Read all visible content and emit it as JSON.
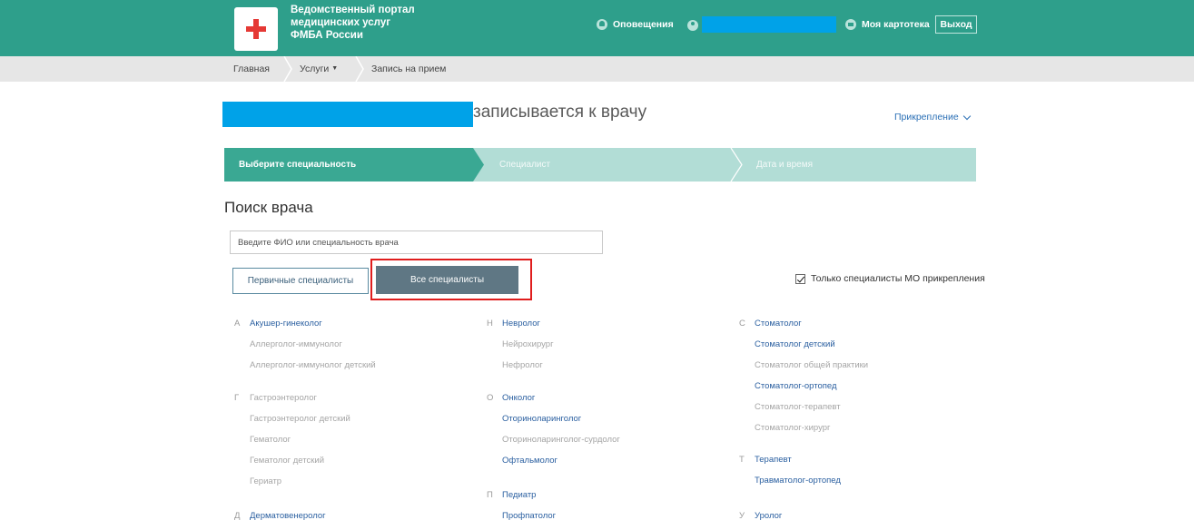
{
  "header": {
    "portal_title_lines": [
      "Ведомственный портал",
      "медицинских услуг",
      "ФМБА России"
    ],
    "notifications_label": "Оповещения",
    "my_card_label": "Моя картотека",
    "exit_label": "Выход",
    "brand_color": "#2e9f8b"
  },
  "breadcrumb": {
    "items": [
      "Главная",
      "Услуги",
      "Запись на прием"
    ]
  },
  "page": {
    "title": "записывается к врачу",
    "attachment_label": "Прикрепление"
  },
  "steps": [
    {
      "label": "Выберите специальность",
      "active": true
    },
    {
      "label": "Специалист",
      "active": false
    },
    {
      "label": "Дата и время",
      "active": false
    }
  ],
  "search": {
    "title": "Поиск врача",
    "placeholder": "Введите ФИО или специальность врача",
    "primary_button": "Первичные специалисты",
    "all_button": "Все специалисты",
    "only_mo_label": "Только специалисты МО прикрепления",
    "only_mo_checked": true
  },
  "specialists": {
    "col_a": [
      {
        "letter": "А",
        "name": "Акушер-гинеколог",
        "active": true
      },
      {
        "letter": "",
        "name": "Аллерголог-иммунолог",
        "active": false
      },
      {
        "letter": "",
        "name": "Аллерголог-иммунолог детский",
        "active": false
      },
      {
        "letter": "Г",
        "name": "Гастроэнтеролог",
        "active": false
      },
      {
        "letter": "",
        "name": "Гастроэнтеролог детский",
        "active": false
      },
      {
        "letter": "",
        "name": "Гематолог",
        "active": false
      },
      {
        "letter": "",
        "name": "Гематолог детский",
        "active": false
      },
      {
        "letter": "",
        "name": "Гериатр",
        "active": false
      },
      {
        "letter": "Д",
        "name": "Дерматовенеролог",
        "active": true
      }
    ],
    "col_b": [
      {
        "letter": "Н",
        "name": "Невролог",
        "active": true
      },
      {
        "letter": "",
        "name": "Нейрохирург",
        "active": false
      },
      {
        "letter": "",
        "name": "Нефролог",
        "active": false
      },
      {
        "letter": "О",
        "name": "Онколог",
        "active": true
      },
      {
        "letter": "",
        "name": "Оториноларинголог",
        "active": true
      },
      {
        "letter": "",
        "name": "Оториноларинголог-сурдолог",
        "active": false
      },
      {
        "letter": "",
        "name": "Офтальмолог",
        "active": true
      },
      {
        "letter": "П",
        "name": "Педиатр",
        "active": true
      },
      {
        "letter": "",
        "name": "Профпатолог",
        "active": true
      }
    ],
    "col_c": [
      {
        "letter": "С",
        "name": "Стоматолог",
        "active": true
      },
      {
        "letter": "",
        "name": "Стоматолог детский",
        "active": true
      },
      {
        "letter": "",
        "name": "Стоматолог общей практики",
        "active": false
      },
      {
        "letter": "",
        "name": "Стоматолог-ортопед",
        "active": true
      },
      {
        "letter": "",
        "name": "Стоматолог-терапевт",
        "active": false
      },
      {
        "letter": "",
        "name": "Стоматолог-хирург",
        "active": false
      },
      {
        "letter": "Т",
        "name": "Терапевт",
        "active": true
      },
      {
        "letter": "",
        "name": "Травматолог-ортопед",
        "active": true
      },
      {
        "letter": "У",
        "name": "Уролог",
        "active": true
      }
    ]
  }
}
